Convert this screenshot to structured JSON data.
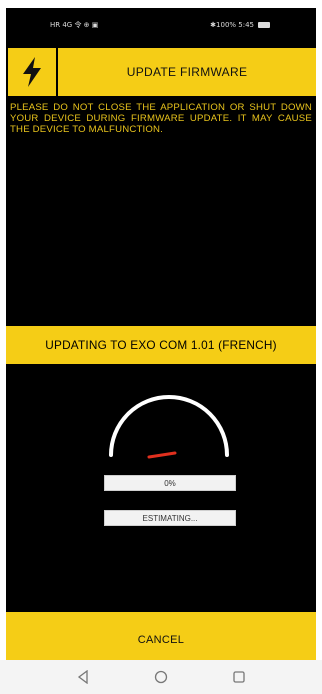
{
  "status_bar": {
    "left": "HR 4G 令 ⊕ ▣",
    "right": "✱100% 5:45"
  },
  "header": {
    "title": "UPDATE FIRMWARE",
    "icon": "lightning-bolt-icon"
  },
  "warning_text": "PLEASE DO NOT CLOSE THE APPLICATION OR SHUT DOWN YOUR DEVICE DURING FIRMWARE UPDATE. IT MAY CAUSE THE DEVICE TO MALFUNCTION.",
  "update_banner": "UPDATING TO EXO COM 1.01 (FRENCH)",
  "progress": {
    "value_fraction": 0.0,
    "percent_label": "0%",
    "time_label": "ESTIMATING..."
  },
  "cancel_label": "CANCEL",
  "navigation": {
    "back_icon": "back-triangle-icon",
    "home_icon": "home-circle-icon",
    "recents_icon": "recents-square-icon"
  },
  "colors": {
    "accent": "#f5cd16",
    "background": "#000000",
    "warning_text": "#e8c31c",
    "needle": "#e0301e"
  }
}
